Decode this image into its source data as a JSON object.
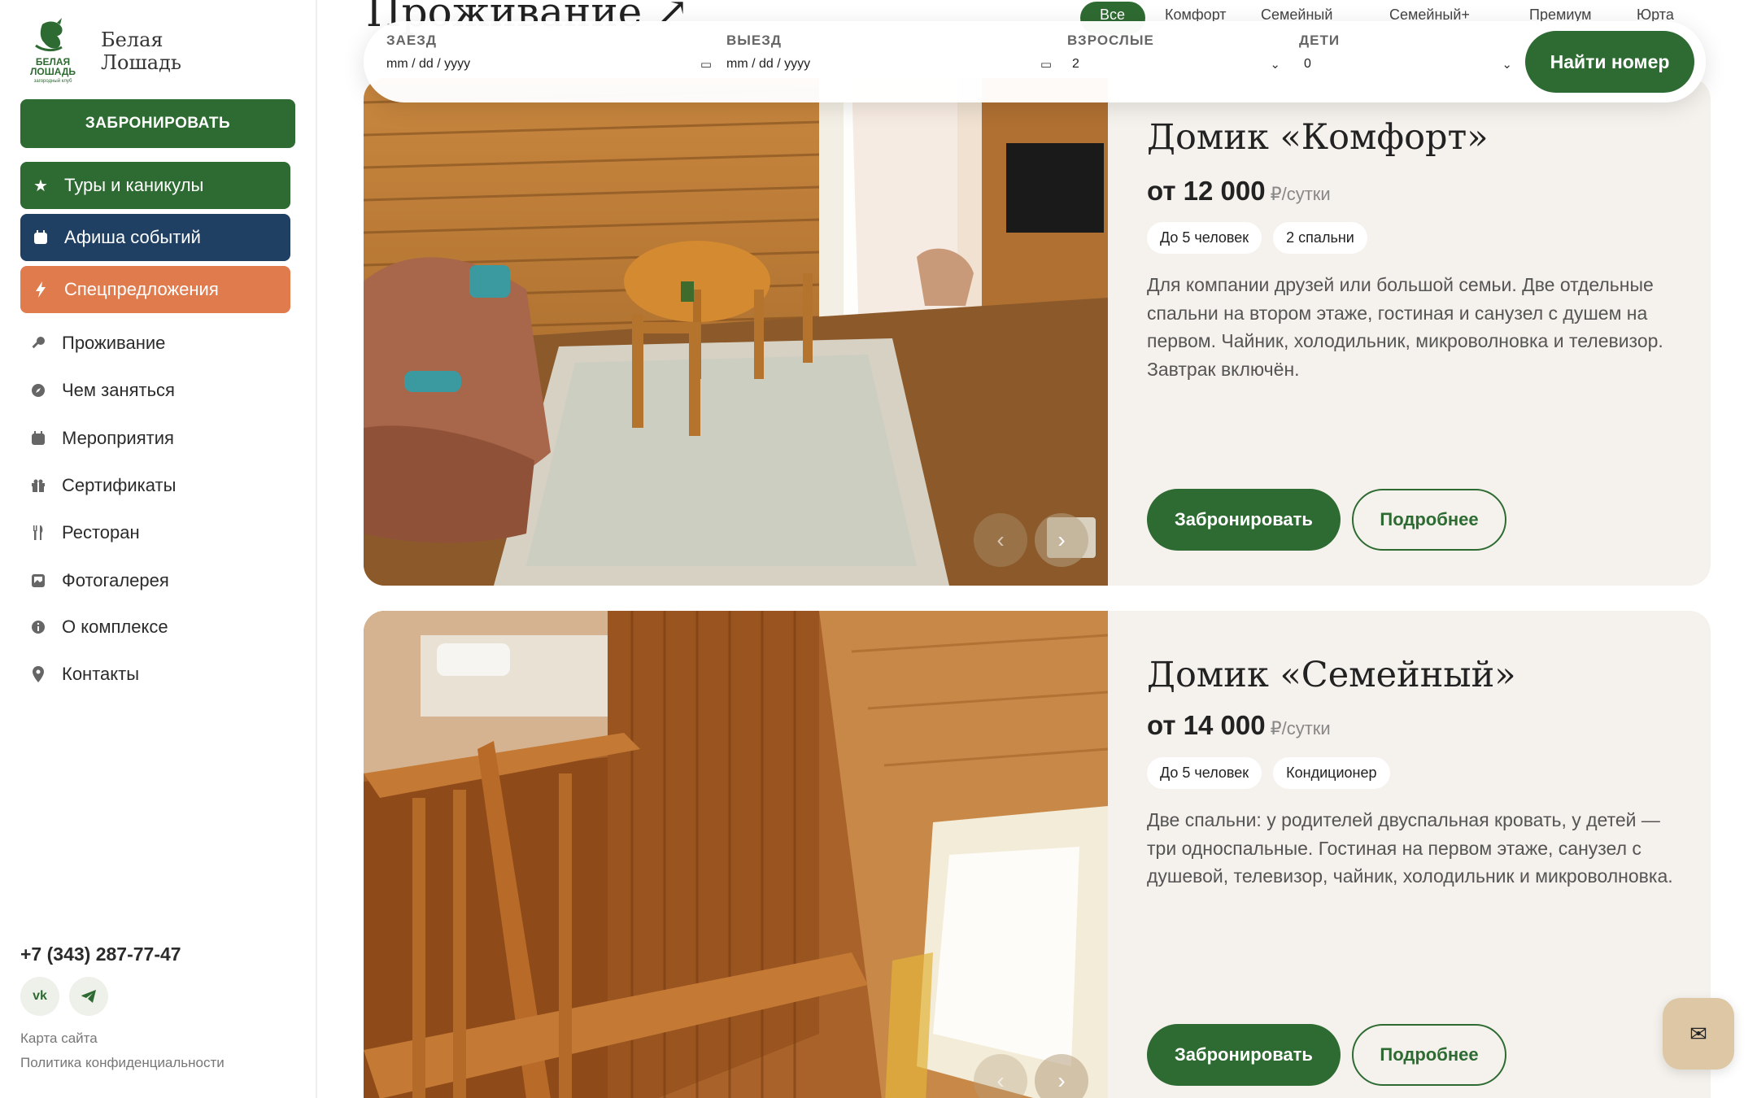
{
  "brand": {
    "line1": "Белая",
    "line2": "Лошадь",
    "mark_line1": "БЕЛАЯ",
    "mark_line2": "ЛОШАДЬ",
    "mark_tagline": "загородный клуб"
  },
  "sidebar": {
    "book_label": "ЗАБРОНИРОВАТЬ",
    "pills": [
      {
        "label": "Туры и каникулы",
        "icon": "star-icon",
        "color": "#2e6b32"
      },
      {
        "label": "Афиша событий",
        "icon": "calendar-icon",
        "color": "#1f3f63"
      },
      {
        "label": "Спецпредложения",
        "icon": "bolt-icon",
        "color": "#e07b4d"
      }
    ],
    "items": [
      {
        "label": "Проживание",
        "icon": "key-icon"
      },
      {
        "label": "Чем заняться",
        "icon": "compass-icon"
      },
      {
        "label": "Мероприятия",
        "icon": "calendar-icon"
      },
      {
        "label": "Сертификаты",
        "icon": "gift-icon"
      },
      {
        "label": "Ресторан",
        "icon": "fork-knife-icon"
      },
      {
        "label": "Фотогалерея",
        "icon": "photo-icon"
      },
      {
        "label": "О комплексе",
        "icon": "info-icon"
      },
      {
        "label": "Контакты",
        "icon": "pin-icon"
      }
    ],
    "phone": "+7 (343) 287-77-47",
    "social": {
      "vk": "vk",
      "telegram": "telegram-icon"
    },
    "sitemap": "Карта сайта",
    "privacy": "Политика конфиденциальности"
  },
  "main": {
    "title": "Проживание ↗",
    "filters": [
      "Все",
      "Комфорт",
      "Семейный",
      "Семейный+",
      "Премиум",
      "Юрта"
    ]
  },
  "search": {
    "checkin_label": "ЗАЕЗД",
    "checkin_value": "mm / dd / yyyy",
    "checkout_label": "ВЫЕЗД",
    "checkout_value": "mm / dd / yyyy",
    "adults_label": "ВЗРОСЛЫЕ",
    "adults_value": "2",
    "kids_label": "ДЕТИ",
    "kids_value": "0",
    "find_label": "Найти номер"
  },
  "cards": [
    {
      "title": "Домик «Комфорт»",
      "price": "от 12 000",
      "unit": "₽/сутки",
      "tags": [
        "До 5 человек",
        "2 спальни"
      ],
      "description": "Для компании друзей или большой семьи. Две отдельные спальни на втором этаже, гостиная и санузел с душем на первом. Чайник, холодильник, микроволновка и телевизор. Завтрак включён.",
      "book_label": "Забронировать",
      "more_label": "Подробнее"
    },
    {
      "title": "Домик «Семейный»",
      "price": "от 14 000",
      "unit": "₽/сутки",
      "tags": [
        "До 5 человек",
        "Кондиционер"
      ],
      "description": "Две спальни: у родителей двуспальная кровать, у детей — три односпальные. Гостиная на первом этаже, санузел с душевой, телевизор, чайник, холодильник и микроволновка.",
      "book_label": "Забронировать",
      "more_label": "Подробнее"
    }
  ],
  "colors": {
    "brand_green": "#2e6b32",
    "navy": "#1f3f63",
    "orange": "#e07b4d",
    "card_bg": "#f5f2ed",
    "chat_bg": "#ddc7a5"
  }
}
